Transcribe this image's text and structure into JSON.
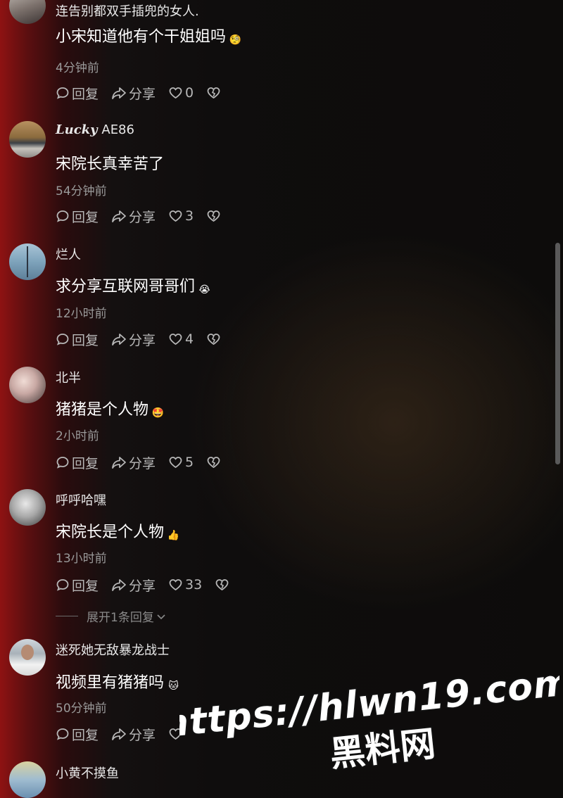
{
  "comments": [
    {
      "username": "连告别都双手插兜的女人.",
      "text": "小宋知道他有个干姐姐吗",
      "emoji": "🧐",
      "time": "4分钟前",
      "reply": "回复",
      "share": "分享",
      "likes": "0"
    },
    {
      "username_styled": "Lucky",
      "username": "AE86",
      "text": "宋院长真幸苦了",
      "time": "54分钟前",
      "reply": "回复",
      "share": "分享",
      "likes": "3"
    },
    {
      "username": "烂人",
      "text": "求分享互联网哥哥们",
      "emoji": "😭",
      "time": "12小时前",
      "reply": "回复",
      "share": "分享",
      "likes": "4"
    },
    {
      "username": "北半",
      "text": "猪猪是个人物",
      "emoji": "🤩",
      "time": "2小时前",
      "reply": "回复",
      "share": "分享",
      "likes": "5"
    },
    {
      "username": "呼呼哈嘿",
      "text": "宋院长是个人物",
      "emoji": "👍",
      "time": "13小时前",
      "reply": "回复",
      "share": "分享",
      "likes": "33",
      "expand_replies": "展开1条回复"
    },
    {
      "username": "迷死她无敌暴龙战士",
      "text": "视频里有猪猪吗",
      "emoji": "🐱",
      "time": "50分钟前",
      "reply": "回复",
      "share": "分享",
      "likes": ""
    },
    {
      "username": "小黄不摸鱼"
    }
  ],
  "watermark": {
    "line1": "https://hlwn19.com",
    "line2": "黑料网"
  },
  "icons": [
    "comment-bubble-icon",
    "share-arrow-icon",
    "heart-icon",
    "broken-heart-icon",
    "chevron-down-icon"
  ]
}
